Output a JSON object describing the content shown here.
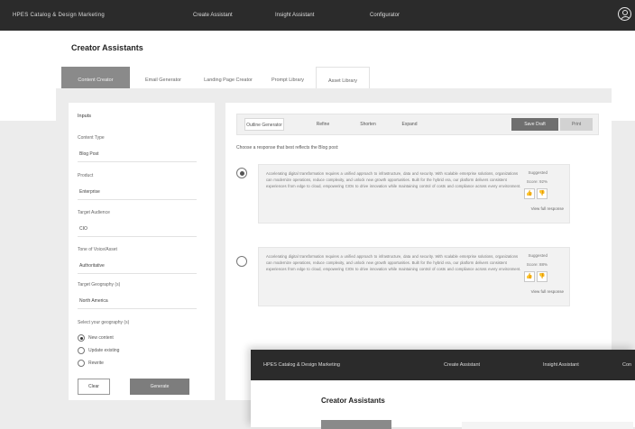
{
  "app": {
    "brand": "HPES Catalog & Design Marketing",
    "nav": [
      "Create Assistant",
      "Insight Assistant",
      "Configurator"
    ]
  },
  "page": {
    "title": "Creator Assistants"
  },
  "tabs": [
    {
      "label": "Content Creator",
      "active": true
    },
    {
      "label": "Email Generator",
      "active": false
    },
    {
      "label": "Landing Page Creator",
      "active": false
    },
    {
      "label": "Prompt Library",
      "active": false
    },
    {
      "label": "Asset Library",
      "active": false,
      "outlined": true
    }
  ],
  "inputs_panel": {
    "title": "Inputs",
    "fields": [
      {
        "label": "Content Type",
        "value": "Blog Post"
      },
      {
        "label": "Product",
        "value": "Enterprise"
      },
      {
        "label": "Target Audience",
        "value": "CIO"
      },
      {
        "label": "Tone of Voice/Asset",
        "value": "Authoritative"
      },
      {
        "label": "Target Geography (s)",
        "value": "North America"
      }
    ],
    "radio_group_label": "Select your geography (s)",
    "radio_options": [
      {
        "label": "New content",
        "selected": true
      },
      {
        "label": "Update existing",
        "selected": false
      },
      {
        "label": "Rewrite",
        "selected": false
      }
    ],
    "reset_label": "Clear",
    "generate_label": "Generate"
  },
  "results_panel": {
    "toolbar": [
      "Outline Generator",
      "Refine",
      "Shorten",
      "Expand"
    ],
    "toolbar_actions": {
      "primary": "Save Draft",
      "secondary": "Print"
    },
    "prompt": "Choose a response that best reflects the Blog post:",
    "options": [
      {
        "selected": true,
        "text": "Accelerating digital transformation requires a unified approach to infrastructure, data and security. With scalable enterprise solutions, organizations can modernize operations, reduce complexity, and unlock new growth opportunities. Built for the hybrid era, our platform delivers consistent experiences from edge to cloud, empowering CIOs to drive innovation while maintaining control of costs and compliance across every environment.",
        "meta_1": "Suggested",
        "meta_2": "Score: 92%",
        "view_label": "View full response"
      },
      {
        "selected": false,
        "text": "Accelerating digital transformation requires a unified approach to infrastructure, data and security. With scalable enterprise solutions, organizations can modernize operations, reduce complexity, and unlock new growth opportunities. Built for the hybrid era, our platform delivers consistent experiences from edge to cloud, empowering CIOs to drive innovation while maintaining control of costs and compliance across every environment.",
        "meta_1": "Suggested",
        "meta_2": "Score: 88%",
        "view_label": "View full response"
      }
    ]
  },
  "overlay": {
    "brand": "HPES Catalog & Design Marketing",
    "nav": [
      "Create Assistant",
      "Insight Assistant",
      "Con"
    ],
    "title": "Creator Assistants"
  }
}
